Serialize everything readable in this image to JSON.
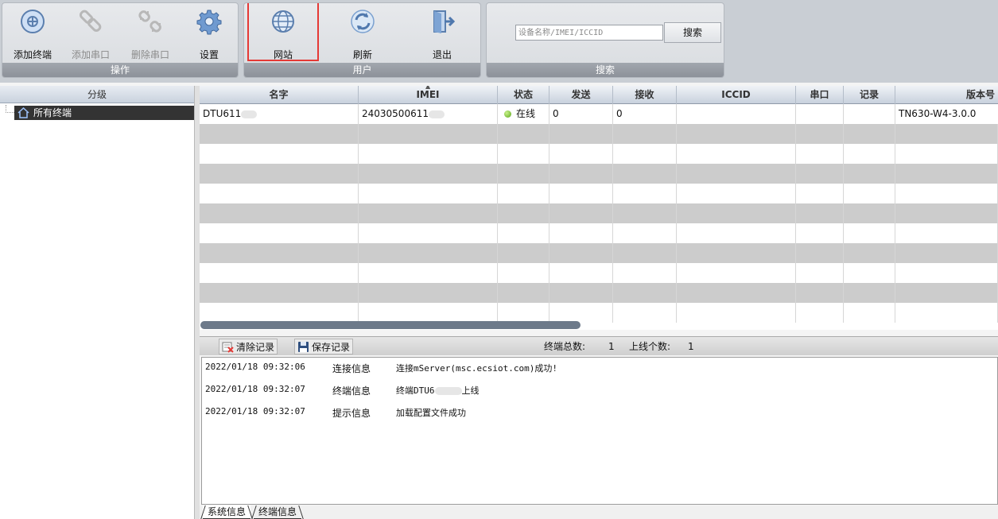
{
  "ribbon": {
    "operate": {
      "caption": "操作",
      "add_terminal": "添加终端",
      "add_port": "添加串口",
      "delete_port": "删除串口",
      "settings": "设置"
    },
    "user": {
      "caption": "用户",
      "website": "网站",
      "refresh": "刷新",
      "exit": "退出"
    },
    "search": {
      "caption": "搜索",
      "placeholder": "设备名称/IMEI/ICCID",
      "button": "搜索"
    }
  },
  "tree": {
    "header": "分级",
    "root": "所有终端"
  },
  "grid": {
    "columns": [
      "名字",
      "IMEI",
      "状态",
      "发送",
      "接收",
      "ICCID",
      "串口",
      "记录",
      "版本号"
    ],
    "rows": [
      {
        "name": "DTU611",
        "imei": "2403050061​1",
        "status": "在线",
        "send": "0",
        "receive": "0",
        "iccid": "",
        "port": "",
        "record": "",
        "version": "TN630-W4-3.0.0"
      }
    ]
  },
  "log_toolbar": {
    "clear": "清除记录",
    "save": "保存记录",
    "total_label": "终端总数:",
    "total_value": "1",
    "online_label": "上线个数:",
    "online_value": "1"
  },
  "log": [
    {
      "time": "2022/01/18 09:32:06",
      "kind": "连接信息",
      "msg": "连接mServer(msc.ecsiot.com)成功!"
    },
    {
      "time": "2022/01/18 09:32:07",
      "kind": "终端信息",
      "msg_pre": "终端DTU6",
      "msg_post": "上线"
    },
    {
      "time": "2022/01/18 09:32:07",
      "kind": "提示信息",
      "msg": "加载配置文件成功"
    }
  ],
  "tabs": {
    "system": "系统信息",
    "terminal": "终端信息"
  },
  "colors": {
    "accent_highlight": "#e53935",
    "online_dot": "#5aa61c",
    "group_caption": "#8c9199"
  }
}
